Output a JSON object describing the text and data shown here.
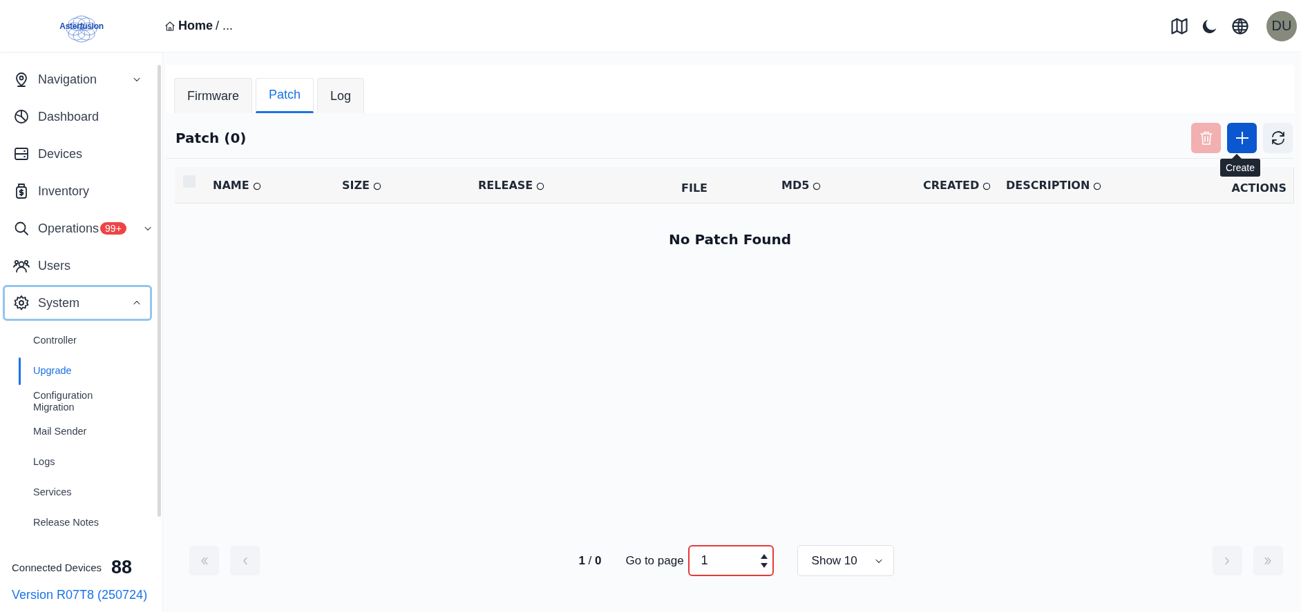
{
  "header": {
    "logo": "Asterfusion",
    "breadcrumb": {
      "current": "Home",
      "rest": "/ ..."
    },
    "actions": [
      {
        "kind": "map"
      },
      {
        "kind": "moon"
      },
      {
        "kind": "globe"
      }
    ],
    "avatar": "DU"
  },
  "sidebar": {
    "items": [
      {
        "label": "Navigation",
        "expanded": false,
        "focused": false
      },
      {
        "label": "Dashboard",
        "focused": false
      },
      {
        "label": "Devices",
        "focused": false
      },
      {
        "label": "Inventory",
        "focused": false
      },
      {
        "label": "Operations",
        "badge": "99+",
        "expanded": false,
        "focused": false
      },
      {
        "label": "Users",
        "focused": false
      },
      {
        "label": "System",
        "expanded": true,
        "focused": true,
        "children": [
          {
            "label": "Controller",
            "selected": false
          },
          {
            "label": "Upgrade",
            "selected": true
          },
          {
            "label": "Configuration Migration",
            "selected": false
          },
          {
            "label": "Mail Sender",
            "selected": false
          },
          {
            "label": "Logs",
            "selected": false
          },
          {
            "label": "Services",
            "selected": false
          },
          {
            "label": "Release Notes",
            "selected": false
          }
        ]
      }
    ],
    "connected_label": "Connected Devices",
    "connected_count": "88",
    "version": "Version R07T8 (250724)"
  },
  "tabs": [
    {
      "label": "Firmware",
      "selected": false
    },
    {
      "label": "Patch",
      "selected": true
    },
    {
      "label": "Log",
      "selected": false
    }
  ],
  "panel": {
    "title": "Patch (0)",
    "buttons": [
      {
        "kind": "delete",
        "disabled": true
      },
      {
        "kind": "create",
        "tooltip": "Create"
      },
      {
        "kind": "refresh"
      }
    ]
  },
  "table": {
    "select_all_checked": false,
    "columns": [
      {
        "label": "NAME",
        "sortable": true
      },
      {
        "label": "SIZE",
        "sortable": true
      },
      {
        "label": "RELEASE",
        "sortable": true
      },
      {
        "label": "FILE",
        "sortable": false
      },
      {
        "label": "MD5",
        "sortable": true
      },
      {
        "label": "CREATED",
        "sortable": true
      },
      {
        "label": "DESCRIPTION",
        "sortable": true
      },
      {
        "label": "ACTIONS",
        "sortable": false
      }
    ],
    "empty_text": "No Patch Found"
  },
  "pagination": {
    "first_disabled": true,
    "prev_disabled": true,
    "page_count": "**1** / **0**",
    "goto_label": "Go to page",
    "goto_value": "1",
    "page_size": "Show 10",
    "next_disabled": true,
    "last_disabled": true
  }
}
